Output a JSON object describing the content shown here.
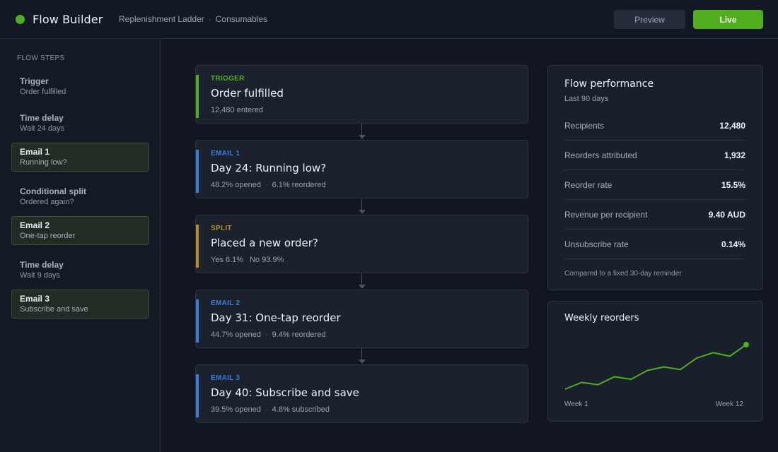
{
  "header": {
    "app_name": "Flow Builder",
    "breadcrumb": [
      "Replenishment Ladder",
      "Consumables"
    ],
    "breadcrumb_separator": "·",
    "preview_label": "Preview",
    "live_label": "Live",
    "brand_color": "#52ad1f"
  },
  "sidebar": {
    "title": "FLOW STEPS",
    "steps": [
      {
        "title": "Trigger",
        "subtitle": "Order fulfilled",
        "active": false
      },
      {
        "title": "Time delay",
        "subtitle": "Wait 24 days",
        "active": false
      },
      {
        "title": "Email 1",
        "subtitle": "Running low?",
        "active": true
      },
      {
        "title": "Conditional split",
        "subtitle": "Ordered again?",
        "active": false
      },
      {
        "title": "Email 2",
        "subtitle": "One-tap reorder",
        "active": true
      },
      {
        "title": "Time delay",
        "subtitle": "Wait 9 days",
        "active": false
      },
      {
        "title": "Email 3",
        "subtitle": "Subscribe and save",
        "active": true
      }
    ]
  },
  "flow": {
    "cards": [
      {
        "kind": "TRIGGER",
        "name": "Order fulfilled",
        "meta": [
          "12,480 entered"
        ],
        "meta_style": "single",
        "accent": "#52ad1f"
      },
      {
        "kind": "EMAIL 1",
        "name": "Day 24: Running low?",
        "meta": [
          "48.2% opened",
          "6.1% reordered"
        ],
        "meta_style": "dot",
        "accent": "#3b7dd8"
      },
      {
        "kind": "SPLIT",
        "name": "Placed a new order?",
        "meta": [
          "Yes 6.1%",
          "No 93.9%"
        ],
        "meta_style": "gap",
        "accent": "#b98a2b"
      },
      {
        "kind": "EMAIL 2",
        "name": "Day 31: One-tap reorder",
        "meta": [
          "44.7% opened",
          "9.4% reordered"
        ],
        "meta_style": "dot",
        "accent": "#3b7dd8"
      },
      {
        "kind": "EMAIL 3",
        "name": "Day 40: Subscribe and save",
        "meta": [
          "39.5% opened",
          "4.8% subscribed"
        ],
        "meta_style": "dot",
        "accent": "#3b7dd8"
      }
    ],
    "meta_dot": "·"
  },
  "performance": {
    "title": "Flow performance",
    "subtitle": "Last 90 days",
    "metrics": [
      {
        "label": "Recipients",
        "value": "12,480"
      },
      {
        "label": "Reorders attributed",
        "value": "1,932"
      },
      {
        "label": "Reorder rate",
        "value": "15.5%"
      },
      {
        "label": "Revenue per recipient",
        "value": "9.40 AUD"
      },
      {
        "label": "Unsubscribe rate",
        "value": "0.14%"
      }
    ],
    "note": "Compared to a fixed 30-day reminder"
  },
  "weekly": {
    "title": "Weekly reorders",
    "start_label": "Week 1",
    "end_label": "Week 12",
    "line_color": "#52ad1f"
  },
  "chart_data": {
    "type": "line",
    "title": "Weekly reorders",
    "x": [
      "Week 1",
      "Week 2",
      "Week 3",
      "Week 4",
      "Week 5",
      "Week 6",
      "Week 7",
      "Week 8",
      "Week 9",
      "Week 10",
      "Week 11",
      "Week 12"
    ],
    "series": [
      {
        "values": [
          0.0,
          0.15,
          0.1,
          0.28,
          0.22,
          0.42,
          0.5,
          0.44,
          0.7,
          0.82,
          0.74,
          1.0
        ]
      }
    ],
    "ylim": [
      0,
      1
    ],
    "grid": false,
    "legend": "none",
    "highlight_last_point": true
  }
}
